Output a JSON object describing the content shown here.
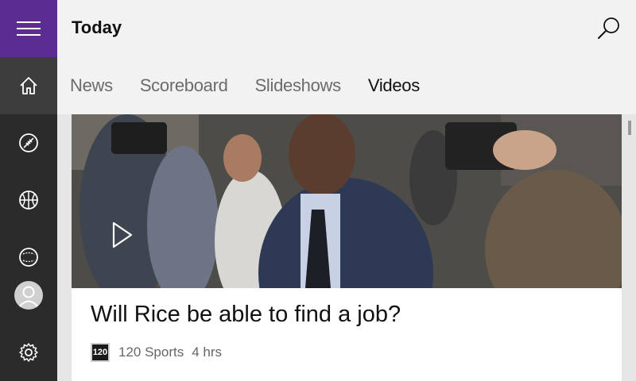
{
  "header": {
    "title": "Today"
  },
  "sidebar": {
    "items": [
      {
        "name": "home",
        "icon": "home-icon"
      },
      {
        "name": "football",
        "icon": "football-icon"
      },
      {
        "name": "basketball",
        "icon": "basketball-icon"
      },
      {
        "name": "baseball",
        "icon": "baseball-icon"
      },
      {
        "name": "profile",
        "icon": "person-icon"
      },
      {
        "name": "settings",
        "icon": "gear-icon"
      }
    ]
  },
  "tabs": [
    "News",
    "Scoreboard",
    "Slideshows",
    "Videos"
  ],
  "selected_tab": "Videos",
  "article": {
    "title": "Will Rice be able to find a job?",
    "source_logo_text": "120",
    "source": "120 Sports",
    "age": "4 hrs"
  },
  "colors": {
    "accent": "#5c2d91",
    "sidebar": "#2b2b2b",
    "sidebar_active": "#3d3d3d",
    "background": "#f2f2f2"
  }
}
